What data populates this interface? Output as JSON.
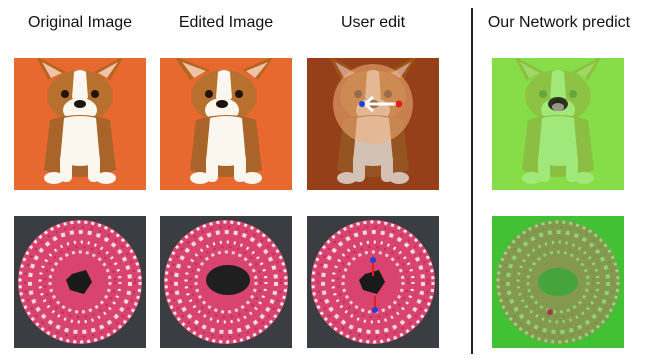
{
  "figure": {
    "columns": [
      {
        "key": "original",
        "title": "Original Image"
      },
      {
        "key": "edited",
        "title": "Edited Image"
      },
      {
        "key": "user_edit",
        "title": "User edit"
      },
      {
        "key": "prediction",
        "title": "Our Network predict"
      }
    ],
    "rows": [
      {
        "subject": "corgi-puppy"
      },
      {
        "subject": "sprinkled-donut"
      }
    ]
  },
  "colors": {
    "corgi_background": "#e8692f",
    "donut_background": "#3a3d42",
    "donut_frosting": "#d9436f",
    "edit_highlight": "#f2b07a",
    "prediction_overlay": "#7ee24d",
    "prediction_background_dark": "#2eaa2e",
    "arrow_white": "#ffffff",
    "handle_red": "#e0201a",
    "handle_blue": "#1f3fd8"
  }
}
